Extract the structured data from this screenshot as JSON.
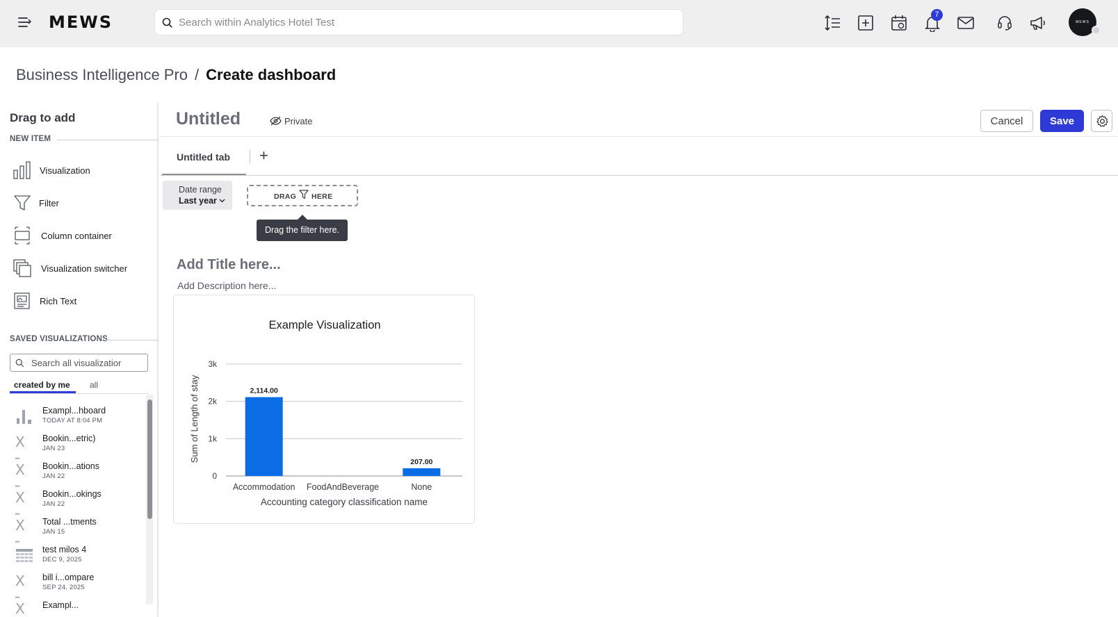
{
  "topbar": {
    "logo": "MEWS",
    "search_placeholder": "Search within Analytics Hotel Test",
    "notification_count": "7",
    "avatar_text": "MEWS"
  },
  "breadcrumb": {
    "parent": "Business Intelligence Pro",
    "separator": "/",
    "current": "Create dashboard"
  },
  "sidebar": {
    "title": "Drag to add",
    "new_item_label": "NEW ITEM",
    "new_items": [
      {
        "label": "Visualization",
        "icon": "bar-chart-icon"
      },
      {
        "label": "Filter",
        "icon": "filter-icon"
      },
      {
        "label": "Column container",
        "icon": "column-container-icon"
      },
      {
        "label": "Visualization switcher",
        "icon": "switcher-icon"
      },
      {
        "label": "Rich Text",
        "icon": "rich-text-icon"
      }
    ],
    "saved_label": "SAVED VISUALIZATIONS",
    "search_placeholder": "Search all visualizatior",
    "tabs": {
      "active": "created by me",
      "inactive": "all"
    },
    "saved_items": [
      {
        "name": "Exampl...hboard",
        "date": "TODAY AT 8:04 PM",
        "icon": "bar-chart-icon"
      },
      {
        "name": "Bookin...etric)",
        "date": "JAN 23",
        "icon": "x-icon"
      },
      {
        "name": "Bookin...ations",
        "date": "JAN 22",
        "icon": "x-icon"
      },
      {
        "name": "Bookin...okings",
        "date": "JAN 22",
        "icon": "x-icon"
      },
      {
        "name": "Total ...tments",
        "date": "JAN 15",
        "icon": "x-icon"
      },
      {
        "name": "test milos 4",
        "date": "DEC 9, 2025",
        "icon": "table-icon"
      },
      {
        "name": "bill i...ompare",
        "date": "SEP 24, 2025",
        "icon": "x-icon"
      },
      {
        "name": "Exampl...",
        "date": "",
        "icon": "x-icon"
      }
    ]
  },
  "dashboard": {
    "title": "Untitled",
    "visibility": "Private",
    "cancel_label": "Cancel",
    "save_label": "Save",
    "tab_label": "Untitled tab",
    "tab_add": "+",
    "filter": {
      "label": "Date range",
      "value": "Last year"
    },
    "drag_zone": {
      "before": "DRAG",
      "after": "HERE"
    },
    "tooltip": "Drag the filter here.",
    "add_title": "Add Title here...",
    "add_description": "Add Description here..."
  },
  "colors": {
    "accent": "#2d3ad6",
    "bar": "#0a6de6"
  },
  "chart_data": {
    "type": "bar",
    "title": "Example Visualization",
    "categories": [
      "Accommodation",
      "FoodAndBeverage",
      "None"
    ],
    "values": [
      2114,
      0,
      207
    ],
    "value_labels": [
      "2,114.00",
      "",
      "207.00"
    ],
    "xlabel": "Accounting category classification name",
    "ylabel": "Sum of Length of stay",
    "yticks": [
      "0",
      "1k",
      "2k",
      "3k"
    ],
    "ylim": [
      0,
      3000
    ],
    "grid": true
  }
}
